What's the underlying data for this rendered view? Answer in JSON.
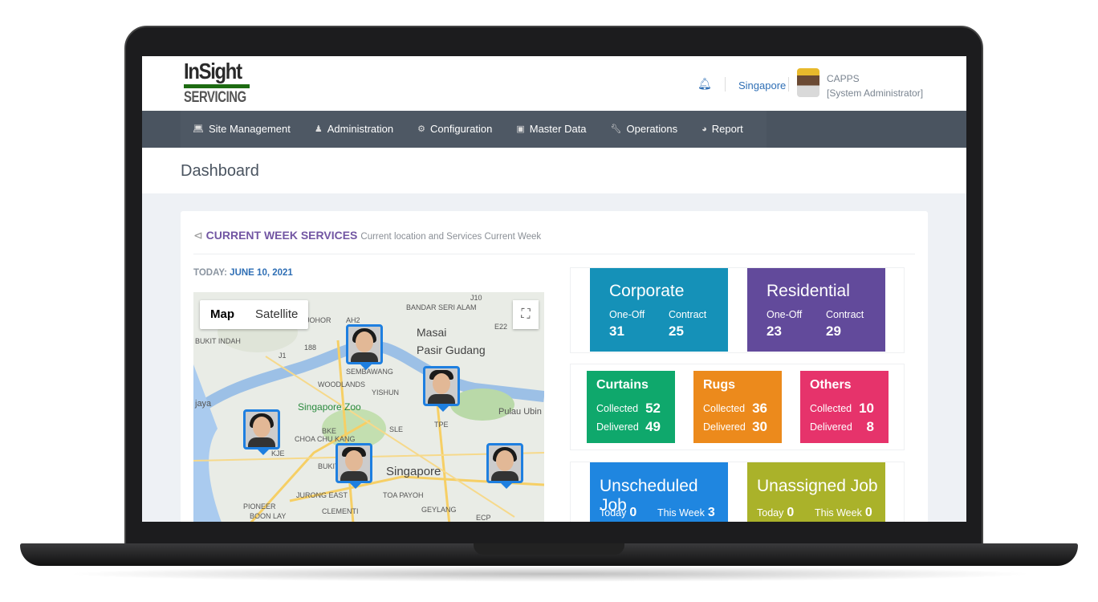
{
  "brand": {
    "line1": "InSight",
    "line2": "SERVICING"
  },
  "header": {
    "location": "Singapore",
    "user_name": "CAPPS",
    "user_role": "[System Administrator]",
    "icons": [
      "bell-icon",
      "avatar"
    ]
  },
  "nav": [
    {
      "label": "Site Management",
      "icon": "laptop-icon"
    },
    {
      "label": "Administration",
      "icon": "user-icon"
    },
    {
      "label": "Configuration",
      "icon": "gear-icon"
    },
    {
      "label": "Master Data",
      "icon": "archive-icon"
    },
    {
      "label": "Operations",
      "icon": "wrench-icon"
    },
    {
      "label": "Report",
      "icon": "pie-chart-icon"
    }
  ],
  "page_title": "Dashboard",
  "card": {
    "title": "CURRENT WEEK SERVICES",
    "subtitle": "Current location and Services Current Week",
    "today_label": "TODAY:",
    "today_value": "JUNE 10, 2021"
  },
  "map": {
    "map_btn": "Map",
    "satellite_btn": "Satellite",
    "labels": [
      "BANDAR SERI ALAM",
      "Masai",
      "JOHOR",
      "BUKIT INDAH",
      "Pasir Gudang",
      "SEMBAWANG",
      "WOODLANDS",
      "YISHUN",
      "Singapore Zoo",
      "Pulau Ubin",
      "jaya",
      "CHOA CHU KANG",
      "BUKIT BATOK",
      "JURONG EAST",
      "CLEMENTI",
      "PIONEER",
      "BOON LAY",
      "TOA PAYOH",
      "GEYLANG",
      "Singapore",
      "AH2",
      "J10",
      "E22",
      "J1",
      "188",
      "TPE",
      "SLE",
      "BKE",
      "KJE",
      "ECP"
    ]
  },
  "corporate": {
    "title": "Corporate",
    "oneoff_label": "One-Off",
    "oneoff": "31",
    "contract_label": "Contract",
    "contract": "25",
    "color": "#1591b8"
  },
  "residential": {
    "title": "Residential",
    "oneoff_label": "One-Off",
    "oneoff": "23",
    "contract_label": "Contract",
    "contract": "29",
    "color": "#624a9b"
  },
  "items": [
    {
      "title": "Curtains",
      "collected_label": "Collected",
      "collected": "52",
      "delivered_label": "Delivered",
      "delivered": "49",
      "color": "#0fa86c"
    },
    {
      "title": "Rugs",
      "collected_label": "Collected",
      "collected": "36",
      "delivered_label": "Delivered",
      "delivered": "30",
      "color": "#ec8a1c"
    },
    {
      "title": "Others",
      "collected_label": "Collected",
      "collected": "10",
      "delivered_label": "Delivered",
      "delivered": "8",
      "color": "#e6336b"
    }
  ],
  "jobs": [
    {
      "title": "Unscheduled Job",
      "today_label": "Today",
      "today": "0",
      "week_label": "This Week",
      "week": "3",
      "color": "#1f86e0"
    },
    {
      "title": "Unassigned Job",
      "today_label": "Today",
      "today": "0",
      "week_label": "This Week",
      "week": "0",
      "color": "#aab22a"
    }
  ]
}
